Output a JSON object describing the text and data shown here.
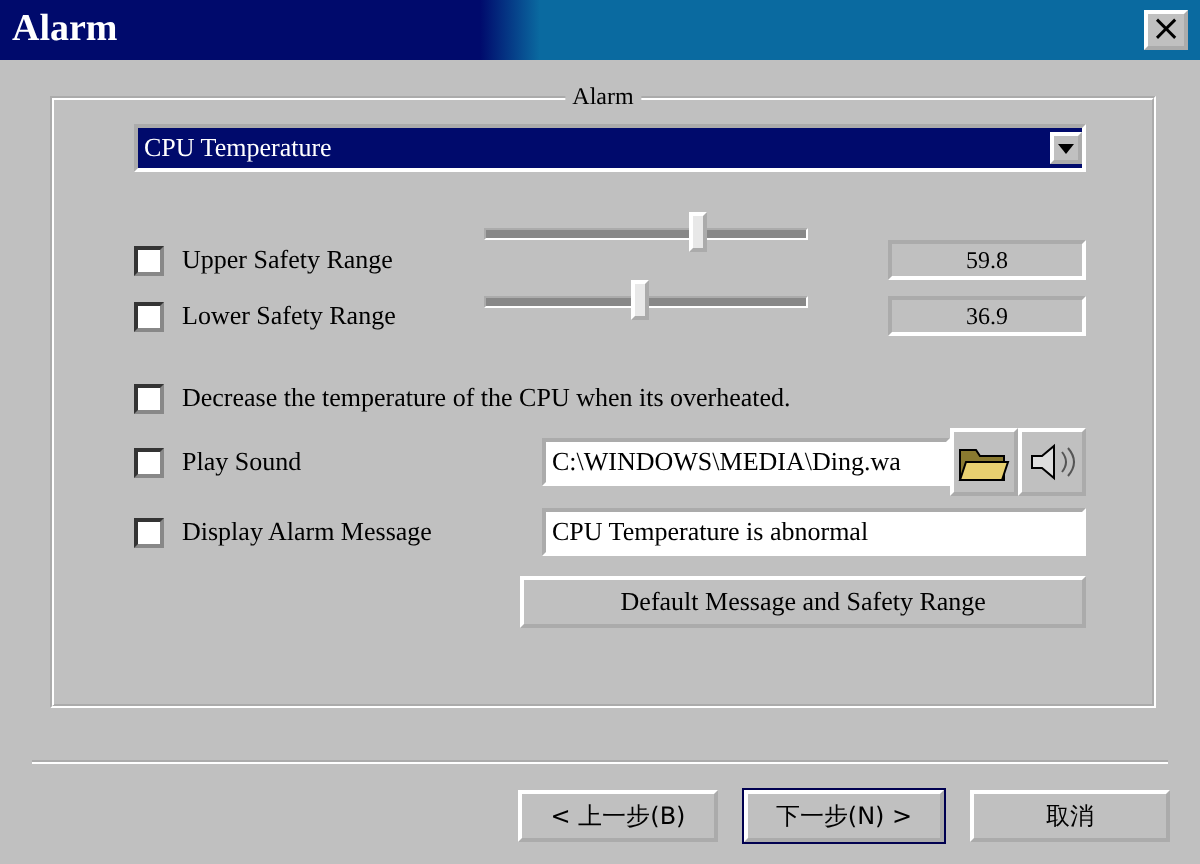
{
  "window": {
    "title": "Alarm",
    "close": "×"
  },
  "group": {
    "title": "Alarm"
  },
  "dropdown": {
    "value": "CPU Temperature"
  },
  "ranges": [
    {
      "label": "Upper Safety Range",
      "checked": false,
      "level": 0.66,
      "reading": "59.8"
    },
    {
      "label": "Lower Safety Range",
      "checked": false,
      "level": 0.48,
      "reading": "36.9"
    }
  ],
  "options": [
    {
      "kind": "plain",
      "label": "Decrease the temperature of the CPU when its overheated.",
      "checked": false
    },
    {
      "kind": "sound",
      "label": "Play Sound",
      "checked": false,
      "value": "C:\\WINDOWS\\MEDIA\\Ding.wa"
    },
    {
      "kind": "message",
      "label": "Display Alarm Message",
      "checked": false,
      "value": "CPU Temperature is abnormal"
    }
  ],
  "default_button": "Default Message and Safety Range",
  "buttons": [
    {
      "label": "< 上一步(B)",
      "selected": false
    },
    {
      "label": "下一步(N) >",
      "selected": true
    },
    {
      "label": "取消",
      "selected": false
    }
  ]
}
